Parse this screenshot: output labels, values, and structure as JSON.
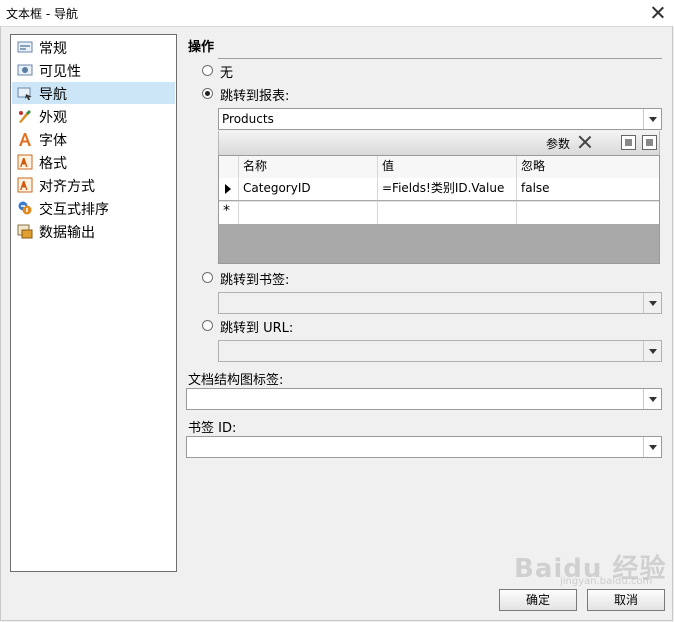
{
  "window": {
    "title": "文本框 - 导航"
  },
  "sidebar": {
    "items": [
      {
        "label": "常规",
        "icon": "general-icon",
        "selected": false
      },
      {
        "label": "可见性",
        "icon": "visibility-icon",
        "selected": false
      },
      {
        "label": "导航",
        "icon": "navigation-icon",
        "selected": true
      },
      {
        "label": "外观",
        "icon": "appearance-icon",
        "selected": false
      },
      {
        "label": "字体",
        "icon": "font-icon",
        "selected": false
      },
      {
        "label": "格式",
        "icon": "format-icon",
        "selected": false
      },
      {
        "label": "对齐方式",
        "icon": "alignment-icon",
        "selected": false
      },
      {
        "label": "交互式排序",
        "icon": "interactive-sort-icon",
        "selected": false
      },
      {
        "label": "数据输出",
        "icon": "data-output-icon",
        "selected": false
      }
    ]
  },
  "action": {
    "section_title": "操作",
    "radio_none": "无",
    "radio_report": "跳转到报表:",
    "radio_bookmark": "跳转到书签:",
    "radio_url": "跳转到 URL:",
    "selected_option": "report",
    "report_value": "Products",
    "bookmark_value": "",
    "url_value": ""
  },
  "params": {
    "label": "参数",
    "columns": [
      "名称",
      "值",
      "忽略"
    ],
    "rows": [
      {
        "name": "CategoryID",
        "value": "=Fields!类别ID.Value",
        "omit": "false"
      }
    ],
    "new_row_marker": "*"
  },
  "doc_map": {
    "label": "文档结构图标签:",
    "value": ""
  },
  "bookmark_id": {
    "label": "书签 ID:",
    "value": ""
  },
  "buttons": {
    "ok": "确定",
    "cancel": "取消"
  },
  "watermark": {
    "text": "Baidu 经验",
    "sub": "jingyan.baidu.com"
  }
}
